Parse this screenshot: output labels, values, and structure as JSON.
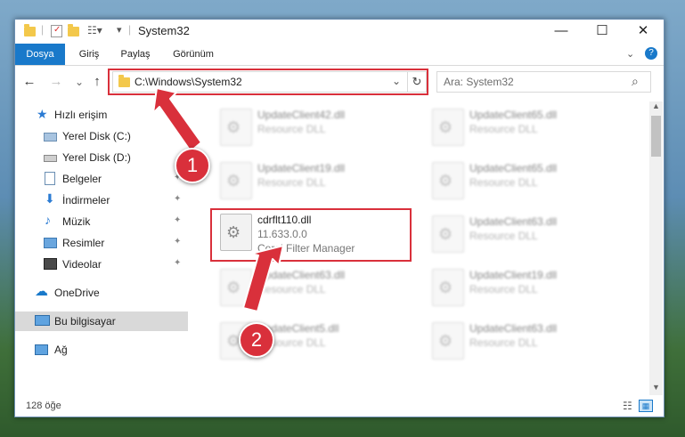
{
  "window": {
    "title": "System32",
    "controls": {
      "minimize": "—",
      "maximize": "☐",
      "close": "✕"
    }
  },
  "ribbon": {
    "tabs": [
      {
        "label": "Dosya",
        "active": true
      },
      {
        "label": "Giriş",
        "active": false
      },
      {
        "label": "Paylaş",
        "active": false
      },
      {
        "label": "Görünüm",
        "active": false
      }
    ],
    "expand_icon": "chevron-down-icon",
    "help_icon": "help-icon",
    "help_glyph": "?"
  },
  "address_bar": {
    "path": "C:\\Windows\\System32",
    "back_glyph": "←",
    "forward_glyph": "→",
    "recent_glyph": "⌄",
    "up_glyph": "↑",
    "dropdown_glyph": "⌄",
    "refresh_glyph": "↻"
  },
  "search": {
    "placeholder": "Ara: System32",
    "glyph": "⌕"
  },
  "sidebar": {
    "items": [
      {
        "label": "Hızlı erişim",
        "icon": "star-icon",
        "pinned": false
      },
      {
        "label": "Yerel Disk (C:)",
        "icon": "drive-icon",
        "pinned": false
      },
      {
        "label": "Yerel Disk (D:)",
        "icon": "drive-icon",
        "pinned": false
      },
      {
        "label": "Belgeler",
        "icon": "document-icon",
        "pinned": true
      },
      {
        "label": "İndirmeler",
        "icon": "download-icon",
        "pinned": true
      },
      {
        "label": "Müzik",
        "icon": "music-icon",
        "pinned": true
      },
      {
        "label": "Resimler",
        "icon": "picture-icon",
        "pinned": true
      },
      {
        "label": "Videolar",
        "icon": "video-icon",
        "pinned": true
      },
      {
        "label": "OneDrive",
        "icon": "cloud-icon",
        "pinned": false
      },
      {
        "label": "Bu bilgisayar",
        "icon": "computer-icon",
        "pinned": false,
        "selected": true
      },
      {
        "label": "Ağ",
        "icon": "network-icon",
        "pinned": false
      }
    ],
    "pin_glyph": "📌"
  },
  "files": {
    "left_column": [
      {
        "name": "UpdateClient42.dll",
        "type": "Resource DLL"
      },
      {
        "name": "UpdateClient19.dll",
        "type": "Resource DLL"
      },
      {
        "name": "cdrflt110.dll",
        "version": "11.633.0.0",
        "description": "Corel Filter Manager",
        "highlighted": true
      },
      {
        "name": "UpdateClient63.dll",
        "type": "Resource DLL"
      },
      {
        "name": "UpdateClient5.dll",
        "type": "Resource DLL"
      }
    ],
    "right_column": [
      {
        "name": "UpdateClient65.dll",
        "type": "Resource DLL"
      },
      {
        "name": "UpdateClient65.dll",
        "type": "Resource DLL"
      },
      {
        "name": "UpdateClient63.dll",
        "type": "Resource DLL"
      },
      {
        "name": "UpdateClient19.dll",
        "type": "Resource DLL"
      },
      {
        "name": "UpdateClient63.dll",
        "type": "Resource DLL"
      }
    ]
  },
  "status_bar": {
    "item_count": "128 öğe"
  },
  "callouts": [
    {
      "number": "1"
    },
    {
      "number": "2"
    }
  ],
  "colors": {
    "accent": "#1979ca",
    "highlight_box": "#d9303b"
  }
}
